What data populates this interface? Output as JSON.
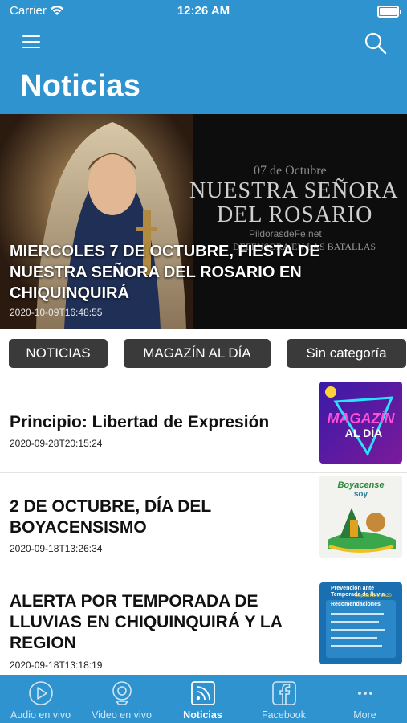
{
  "status_bar": {
    "carrier": "Carrier",
    "time": "12:26 AM"
  },
  "header": {
    "title": "Noticias"
  },
  "hero": {
    "title": "MIERCOLES 7 DE OCTUBRE, FIESTA DE NUESTRA SEÑORA DEL ROSARIO EN CHIQUINQUIRÁ",
    "date": "2020-10-09T16:48:55",
    "image_text": {
      "date_line": "07 de Octubre",
      "line1": "NUESTRA SEÑORA",
      "line2": "DEL ROSARIO",
      "site": "PildorasdeFe.net",
      "sub": "DEFENSORA EN LAS BATALLAS"
    }
  },
  "categories": [
    "NOTICIAS",
    "MAGAZÍN AL DÍA",
    "Sin categoría"
  ],
  "articles": [
    {
      "title": "Principio: Libertad de Expresión",
      "date": "2020-09-28T20:15:24",
      "thumb_text": {
        "top": "MAGAZÍN",
        "bottom": "AL DÍA"
      }
    },
    {
      "title": "2 DE OCTUBRE, DÍA DEL BOYACENSISMO",
      "date": "2020-09-18T13:26:34",
      "thumb_text": {
        "top": "Boyacense",
        "bottom": "soy"
      }
    },
    {
      "title": "ALERTA POR TEMPORADA DE LLUVIAS EN CHIQUINQUIRÁ Y LA REGION",
      "date": "2020-09-18T13:18:19",
      "thumb_text": {
        "top": "Prevención ante Temporada de lluvia",
        "sub": "Septiembre 2020",
        "box": "Recomendaciones"
      }
    }
  ],
  "tabs": [
    {
      "label": "Audio en vivo",
      "icon": "play-circle-icon"
    },
    {
      "label": "Video en vivo",
      "icon": "webcam-icon"
    },
    {
      "label": "Noticias",
      "icon": "rss-icon",
      "active": true
    },
    {
      "label": "Facebook",
      "icon": "facebook-icon"
    },
    {
      "label": "More",
      "icon": "more-dots-icon"
    }
  ],
  "colors": {
    "brand": "#2f93cf",
    "chip": "#3a3a3a"
  }
}
